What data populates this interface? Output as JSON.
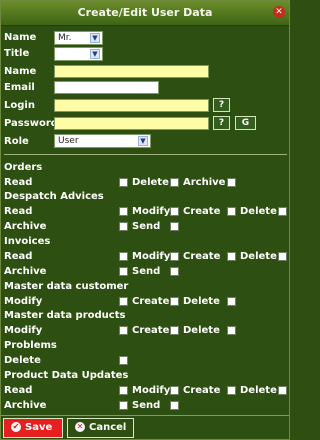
{
  "window": {
    "title": "Create/Edit User Data"
  },
  "form": {
    "name_title_label": "Name",
    "name_title_value": "Mr.",
    "title_label": "Title",
    "title_value": "",
    "name_label": "Name",
    "name_value": "",
    "email_label": "Email",
    "email_value": "",
    "login_label": "Login",
    "login_value": "",
    "password_label": "Password",
    "password_value": "",
    "role_label": "Role",
    "role_value": "User",
    "help_btn": "?",
    "generate_btn": "G"
  },
  "sections": [
    {
      "title": "Orders",
      "rows": [
        [
          "Read",
          "Delete",
          "Archive"
        ]
      ]
    },
    {
      "title": "Despatch Advices",
      "rows": [
        [
          "Read",
          "Modify",
          "Create",
          "Delete"
        ],
        [
          "Archive",
          "Send"
        ]
      ]
    },
    {
      "title": "Invoices",
      "rows": [
        [
          "Read",
          "Modify",
          "Create",
          "Delete"
        ],
        [
          "Archive",
          "Send"
        ]
      ]
    },
    {
      "title": "Master data customer",
      "rows": [
        [
          "Modify",
          "Create",
          "Delete"
        ]
      ]
    },
    {
      "title": "Master data products",
      "rows": [
        [
          "Modify",
          "Create",
          "Delete"
        ]
      ]
    },
    {
      "title": "Problems",
      "rows": [
        [
          "Delete"
        ]
      ]
    },
    {
      "title": "Product Data Updates",
      "rows": [
        [
          "Read",
          "Modify",
          "Create",
          "Delete"
        ],
        [
          "Archive",
          "Send"
        ]
      ]
    }
  ],
  "footer": {
    "save_label": "Save",
    "cancel_label": "Cancel"
  },
  "colors": {
    "background": "#2f4f12",
    "titlebar": "#4f7520",
    "input_highlight": "#fffca6",
    "save_button": "#e62020",
    "cancel_button": "#2f4f12"
  }
}
